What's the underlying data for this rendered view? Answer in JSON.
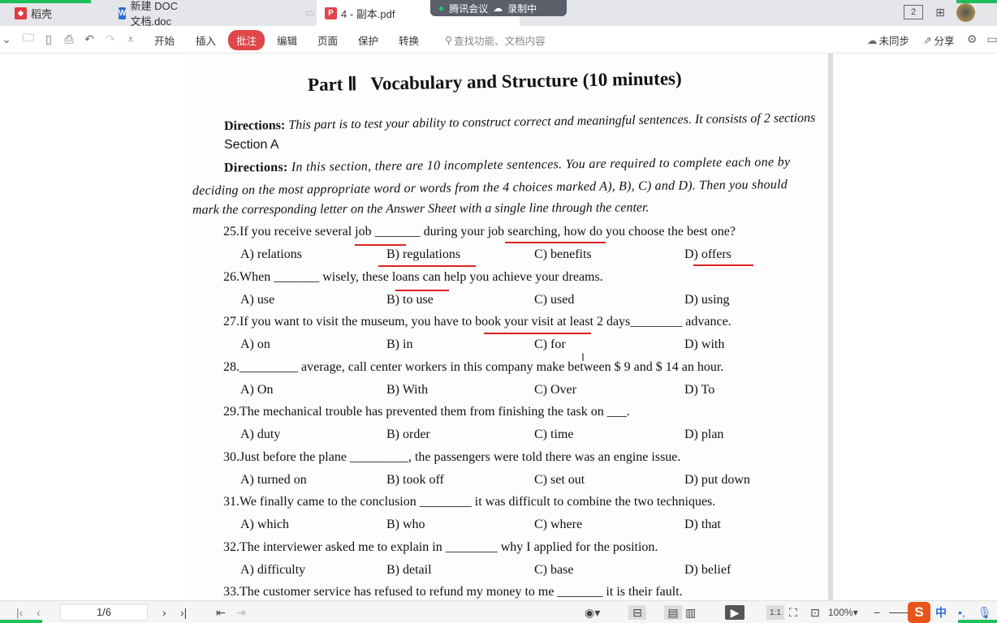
{
  "tabs": [
    {
      "label": "稻壳",
      "icon": "daoke-icon",
      "color": "#e0393e"
    },
    {
      "label": "新建 DOC 文档.doc",
      "icon": "word-icon",
      "color": "#2f6fd6"
    },
    {
      "label": "4 - 副本.pdf",
      "icon": "pdf-icon",
      "color": "#e0464a"
    }
  ],
  "meeting": {
    "label": "腾讯会议",
    "record": "录制中"
  },
  "topright": {
    "page_count": "2"
  },
  "toolbar": {
    "menus": [
      "开始",
      "插入",
      "批注",
      "编辑",
      "页面",
      "保护",
      "转换"
    ],
    "active": "批注",
    "search_placeholder": "查找功能、文档内容",
    "sync": "未同步",
    "share": "分享"
  },
  "document": {
    "title": "Part Ⅱ   Vocabulary and Structure (10 minutes)",
    "dir1_label": "Directions:",
    "dir1": " This part is to test your ability to construct correct and meaningful sentences. It consists of 2 sections",
    "section": "Section A",
    "dir2_label": "Directions:",
    "dir2": " In this section, there are 10 incomplete sentences. You are required to complete each one by",
    "dir2b": "deciding on the most appropriate word or words from the 4 choices marked A), B), C) and D). Then you should",
    "dir2c": "mark the corresponding letter on the Answer Sheet with a single line through the center.",
    "questions": [
      {
        "text": "25.If you receive several job _______ during your job searching, how do you choose the best one?",
        "options": [
          "A) relations",
          "B) regulations",
          "C) benefits",
          "D) offers"
        ]
      },
      {
        "text": "26.When _______ wisely, these loans can help you achieve your dreams.",
        "options": [
          "A) use",
          "B) to use",
          "C) used",
          "D) using"
        ]
      },
      {
        "text": "27.If you want to visit the museum, you have to book your visit at least 2 days________ advance.",
        "options": [
          "A) on",
          "B) in",
          "C) for",
          "D) with"
        ]
      },
      {
        "text": "28._________ average, call center workers in this company make between $ 9 and $ 14 an hour.",
        "options": [
          "A) On",
          "B) With",
          "C) Over",
          "D) To"
        ]
      },
      {
        "text": "29.The mechanical trouble has prevented them from finishing the task on ___.",
        "options": [
          "A) duty",
          "B) order",
          "C) time",
          "D) plan"
        ]
      },
      {
        "text": "30.Just before the plane _________, the passengers were told there was an engine issue.",
        "options": [
          "A) turned on",
          "B) took off",
          "C) set out",
          "D) put down"
        ]
      },
      {
        "text": "31.We finally came to the conclusion ________ it was difficult to combine the two techniques.",
        "options": [
          "A) which",
          "B) who",
          "C) where",
          "D) that"
        ]
      },
      {
        "text": "32.The interviewer asked me to explain in ________ why I applied for the position.",
        "options": [
          "A) difficulty",
          "B) detail",
          "C) base",
          "D) belief"
        ]
      },
      {
        "text": "33.The customer service has refused to refund my money to me _______ it is their fault.",
        "options": []
      }
    ]
  },
  "status": {
    "page": "1/6",
    "zoom": "100%",
    "ime": "中"
  }
}
